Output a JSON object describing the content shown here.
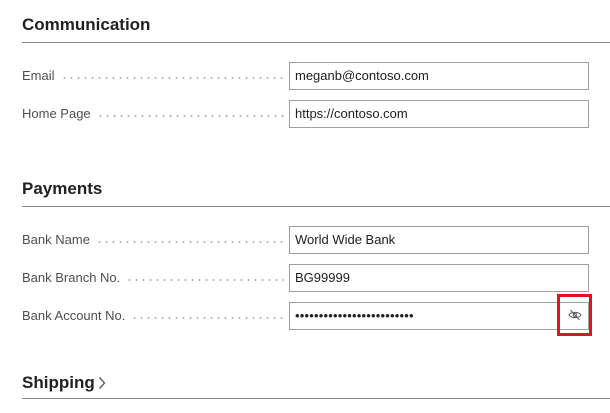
{
  "communication": {
    "title": "Communication",
    "fields": [
      {
        "label": "Email",
        "value": "meganb@contoso.com"
      },
      {
        "label": "Home Page",
        "value": "https://contoso.com"
      }
    ]
  },
  "payments": {
    "title": "Payments",
    "fields": [
      {
        "label": "Bank Name",
        "value": "World Wide Bank"
      },
      {
        "label": "Bank Branch No.",
        "value": "BG99999"
      },
      {
        "label": "Bank Account No.",
        "value": "•••••••••••••••••••••••••"
      }
    ],
    "reveal_icon": "eye-off-icon",
    "highlight_color": "#e0141e"
  },
  "shipping": {
    "title": "Shipping",
    "icon": "chevron-right-icon"
  }
}
